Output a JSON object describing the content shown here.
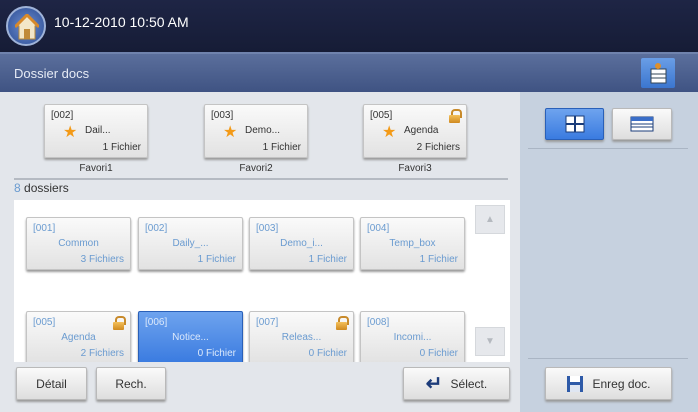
{
  "header": {
    "datetime": "10-12-2010 10:50 AM"
  },
  "titlebar": {
    "title": "Dossier docs"
  },
  "favorites": [
    {
      "id": "[002]",
      "name": "Dail...",
      "count": "1 Fichier",
      "label": "Favori1",
      "locked": false
    },
    {
      "id": "[003]",
      "name": "Demo...",
      "count": "1 Fichier",
      "label": "Favori2",
      "locked": false
    },
    {
      "id": "[005]",
      "name": "Agenda",
      "count": "2 Fichiers",
      "label": "Favori3",
      "locked": true
    }
  ],
  "folder_count": {
    "number": "8",
    "label": " dossiers"
  },
  "folders": [
    {
      "id": "[001]",
      "name": "Common",
      "count": "3 Fichiers"
    },
    {
      "id": "[002]",
      "name": "Daily_...",
      "count": "1 Fichier"
    },
    {
      "id": "[003]",
      "name": "Demo_i...",
      "count": "1 Fichier"
    },
    {
      "id": "[004]",
      "name": "Temp_box",
      "count": "1 Fichier"
    },
    {
      "id": "[005]",
      "name": "Agenda",
      "count": "2 Fichiers",
      "locked": true
    },
    {
      "id": "[006]",
      "name": "Notice...",
      "count": "0 Fichier",
      "selected": true
    },
    {
      "id": "[007]",
      "name": "Releas...",
      "count": "0 Fichier",
      "locked": true
    },
    {
      "id": "[008]",
      "name": "Incomi...",
      "count": "0 Fichier"
    }
  ],
  "buttons": {
    "detail": "Détail",
    "search": "Rech.",
    "select": "Sélect.",
    "save": "Enreg doc."
  },
  "icons": {
    "up": "▲",
    "down": "▼",
    "star": "★",
    "enter": "↵"
  }
}
